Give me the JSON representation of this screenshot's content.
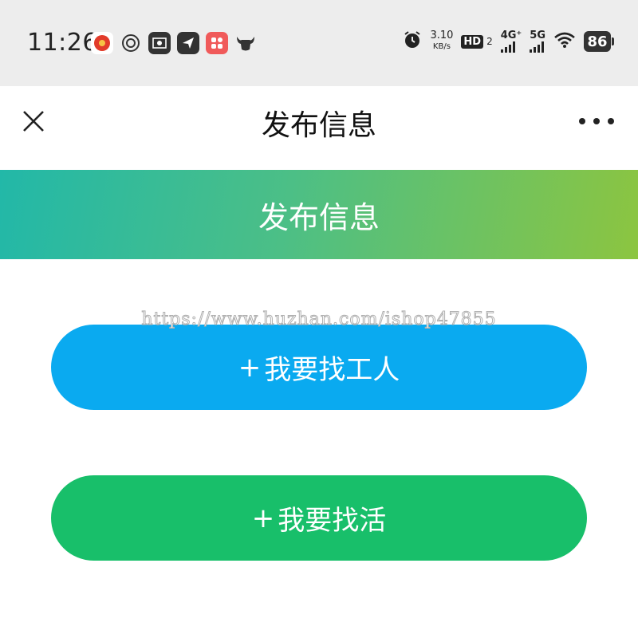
{
  "status_bar": {
    "time": "11:26",
    "speed_value": "3.10",
    "speed_unit": "KB/s",
    "hd": "HD",
    "hd_sub": "2",
    "net_4g": "4G⁺",
    "net_5g": "5G",
    "battery": "86"
  },
  "nav": {
    "title": "发布信息"
  },
  "banner": {
    "title": "发布信息"
  },
  "watermark": "https://www.huzhan.com/ishop47855",
  "actions": {
    "find_worker": {
      "plus": "+",
      "label": "我要找工人",
      "color": "#0aaaf0"
    },
    "find_job": {
      "plus": "+",
      "label": "我要找活",
      "color": "#18bf6a"
    }
  },
  "colors": {
    "banner_start": "#22b8a8",
    "banner_end": "#8cc540",
    "status_bg": "#ededed"
  }
}
